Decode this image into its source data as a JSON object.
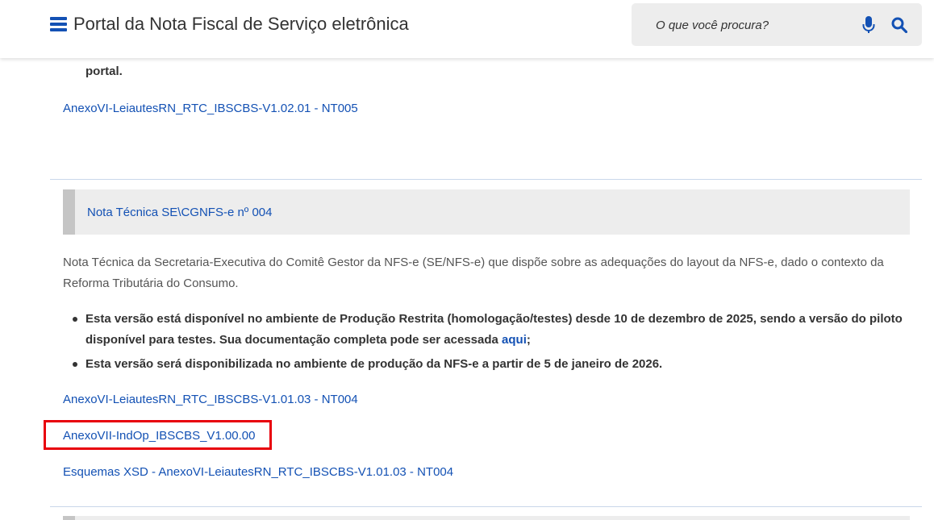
{
  "header": {
    "title": "Portal da Nota Fiscal de Serviço eletrônica",
    "search_placeholder": "O que você procura?"
  },
  "prev_section": {
    "leftover_text": "portal.",
    "link": "AnexoVI-LeiautesRN_RTC_IBSCBS-V1.02.01 - NT005"
  },
  "section": {
    "title": "Nota Técnica SE\\CGNFS-e nº 004",
    "description": "Nota Técnica da Secretaria-Executiva do Comitê Gestor da NFS-e (SE/NFS-e) que dispõe sobre as adequações do layout da NFS-e, dado o contexto da Reforma Tributária do Consumo.",
    "bullets": [
      {
        "text": "Esta versão está disponível no ambiente de Produção Restrita (homologação/testes) desde 10 de dezembro de 2025, sendo a versão do piloto disponível para testes. Sua documentação completa pode ser acessada ",
        "link": "aqui",
        "suffix": ";"
      },
      {
        "text": "Esta versão será disponibilizada no ambiente de produção da NFS-e a partir de 5 de janeiro de 2026."
      }
    ],
    "links": [
      "AnexoVI-LeiautesRN_RTC_IBSCBS-V1.01.03 - NT004",
      "AnexoVII-IndOp_IBSCBS_V1.00.00",
      "Esquemas XSD - AnexoVI-LeiautesRN_RTC_IBSCBS-V1.01.03 - NT004"
    ]
  },
  "colors": {
    "link": "#1351b4",
    "highlight": "#e8000b"
  }
}
